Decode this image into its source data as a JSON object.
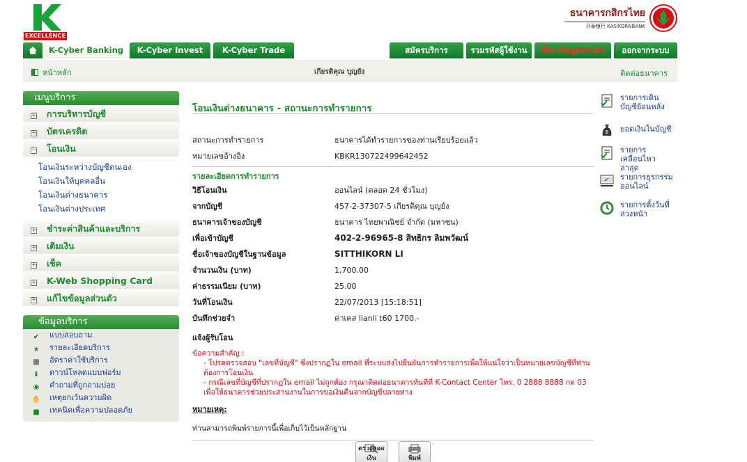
{
  "header": {
    "logo_text": "EXCELLENCE",
    "bank_name_th": "ธนาคารกสิกรไทย",
    "bank_name_en": "开泰银行 KASIKORNBANK"
  },
  "nav": {
    "tabs": [
      "K-Cyber Banking",
      "K-Cyber Invest",
      "K-Cyber Trade"
    ],
    "right_tabs": [
      "สมัครบริการ",
      "รวมรหัสผู้ใช้งาน",
      "ตั้งค่าข้อมูลส่วนตัว",
      "ออกจากระบบ"
    ]
  },
  "subbar": {
    "home": "หน้าหลัก",
    "user": "เกียรติคุณ บุญยัง",
    "contact": "ติดต่อธนาคาร"
  },
  "sidebar": {
    "title": "เมนูบริการ",
    "items": [
      "การบริหารบัญชี",
      "บัตรเครดิต",
      "โอนเงิน",
      "ชำระค่าสินค้าและบริการ",
      "เติมเงิน",
      "เช็ค",
      "K-Web Shopping Card",
      "แก้ไขข้อมูลส่วนตัว"
    ],
    "transfer_sub": [
      "โอนเงินระหว่างบัญชีตนเอง",
      "โอนเงินให้บุคคลอื่น",
      "โอนเงินต่างธนาคาร",
      "โอนเงินต่างประเทศ"
    ]
  },
  "info": {
    "title": "ข้อมูลบริการ",
    "items": [
      "แบบสอบถาม",
      "รายละเอียดบริการ",
      "อัตราค่าใช้บริการ",
      "ดาวน์โหลดแบบฟอร์ม",
      "คำถามที่ถูกถามบ่อย",
      "เหตุยกเว้นความผิด",
      "เทคนิคเพื่อความปลอดภัย"
    ]
  },
  "main": {
    "title": "โอนเงินต่างธนาคาร - สถานะการทำรายการ",
    "status_label": "สถานะการทำรายการ",
    "status_value": "ธนาคารได้ทำรายการของท่านเรียบร้อยแล้ว",
    "ref_label": "หมายเลขอ้างอิง",
    "ref_value": "KBKR130722499642452",
    "detail_title": "รายละเอียดการทำรายการ",
    "rows": [
      {
        "label": "วิธีโอนเงิน",
        "value": "ออนไลน์ (ตลอด 24 ชั่วโมง)"
      },
      {
        "label": "จากบัญชี",
        "value": "457-2-37307-5 เกียรติคุณ บุญยัง"
      },
      {
        "label": "ธนาคารเจ้าของบัญชี",
        "value": "ธนาคาร ไทยพาณิชย์ จำกัด (มหาชน)"
      },
      {
        "label": "เพื่อเข้าบัญชี",
        "value": "402-2-96965-8 สิทธิกร ลิมพวัฒน์"
      },
      {
        "label": "ชื่อเจ้าของบัญชีในฐานข้อมูล",
        "value": "SITTHIKORN LI"
      },
      {
        "label": "จำนวนเงิน (บาท)",
        "value": "1,700.00"
      },
      {
        "label": "ค่าธรรมเนียม (บาท)",
        "value": "25.00"
      },
      {
        "label": "วันที่โอนเงิน",
        "value": "22/07/2013 [15:18:51]"
      },
      {
        "label": "บันทึกช่วยจำ",
        "value": "ค่าเคส lianli t60 1700.-"
      }
    ],
    "notify_label": "แจ้งผู้รับโอน",
    "important_title": "ข้อความสำคัญ :",
    "important_1": "- โปรดตรวจสอบ \"เลขที่บัญชี\" ซึ่งปรากฏใน email ที่ระบบส่งไปยืนยันการทำรายการเพื่อให้แน่ใจว่าเป็นหมายเลขบัญชีที่ท่านต้องการโอนเงิน",
    "important_2": "- กรณีเลขที่บัญชีที่ปรากฏใน email ไม่ถูกต้อง กรุณาติดต่อธนาคารทันทีที่ K-Contact Center โทร. 0 2888 8888 กด 03 เพื่อให้ธนาคารช่วยประสานงานในการขอเงินคืนจากบัญชีปลายทาง",
    "remark_title": "หมายเหตุ:",
    "remark_text": "ท่านสามารถพิมพ์รายการนี้เพื่อเก็บไว้เป็นหลักฐาน",
    "btn_check": "ตรวจยอดเงิน",
    "btn_print": "พิมพ์"
  },
  "quick": [
    {
      "label": "รายการเดินบัญชีย้อนหลัง",
      "icon": "statement-icon"
    },
    {
      "label": "ยอดเงินในบัญชี",
      "icon": "money-bag-icon"
    },
    {
      "label": "รายการเคลื่อนไหวล่าสุด",
      "icon": "recent-icon"
    },
    {
      "label": "รายการธุรกรรมออนไลน์",
      "icon": "online-icon"
    },
    {
      "label": "รายการตั้งวันที่ล่วงหน้า",
      "icon": "clock-icon"
    }
  ]
}
